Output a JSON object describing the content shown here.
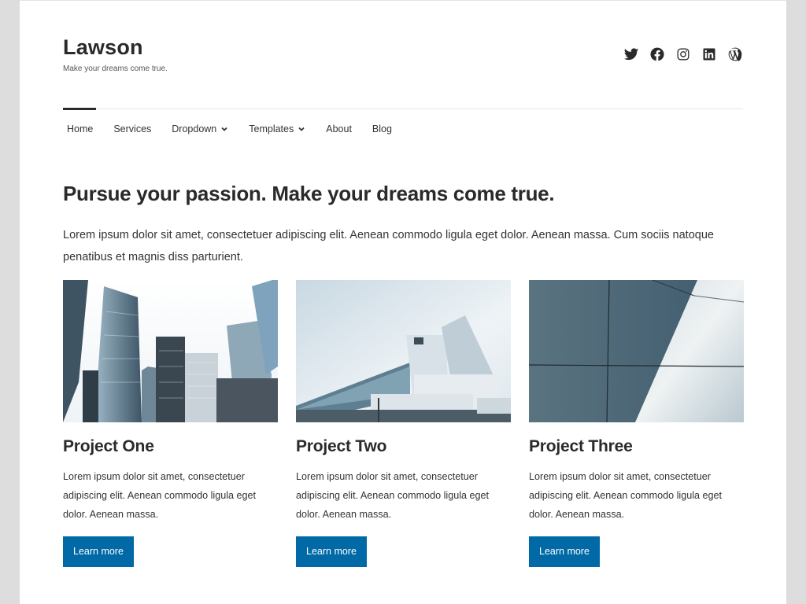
{
  "site": {
    "title": "Lawson",
    "tagline": "Make your dreams come true."
  },
  "social": [
    {
      "name": "twitter-icon",
      "label": "Twitter"
    },
    {
      "name": "facebook-icon",
      "label": "Facebook"
    },
    {
      "name": "instagram-icon",
      "label": "Instagram"
    },
    {
      "name": "linkedin-icon",
      "label": "LinkedIn"
    },
    {
      "name": "wordpress-icon",
      "label": "WordPress"
    }
  ],
  "nav": {
    "items": [
      {
        "label": "Home",
        "active": true,
        "has_dropdown": false
      },
      {
        "label": "Services",
        "has_dropdown": false
      },
      {
        "label": "Dropdown",
        "has_dropdown": true
      },
      {
        "label": "Templates",
        "has_dropdown": true
      },
      {
        "label": "About",
        "has_dropdown": false
      },
      {
        "label": "Blog",
        "has_dropdown": false
      }
    ]
  },
  "hero": {
    "title": "Pursue your passion. Make your dreams come true.",
    "text": "Lorem ipsum dolor sit amet, consectetuer adipiscing elit. Aenean commodo ligula eget dolor. Aenean massa. Cum sociis natoque penatibus et magnis diss parturient."
  },
  "projects": [
    {
      "title": "Project One",
      "image": "skyscrapers-photo",
      "text": "Lorem ipsum dolor sit amet, consectetuer adipiscing elit. Aenean commodo ligula eget dolor. Aenean massa.",
      "button": "Learn more"
    },
    {
      "title": "Project Two",
      "image": "modern-glass-building-photo",
      "text": "Lorem ipsum dolor sit amet, consectetuer adipiscing elit. Aenean commodo ligula eget dolor. Aenean massa.",
      "button": "Learn more"
    },
    {
      "title": "Project Three",
      "image": "facade-panels-photo",
      "text": "Lorem ipsum dolor sit amet, consectetuer adipiscing elit. Aenean commodo ligula eget dolor. Aenean massa.",
      "button": "Learn more"
    }
  ],
  "colors": {
    "accent": "#0069a6",
    "text": "#2a2a2a",
    "background": "#dddddd"
  }
}
